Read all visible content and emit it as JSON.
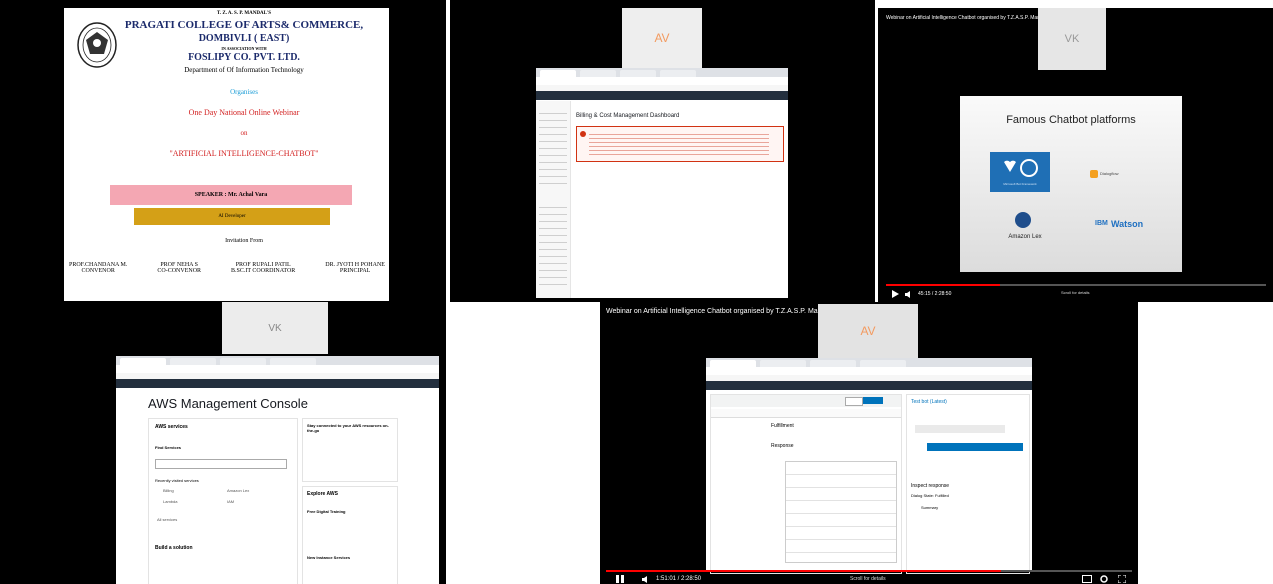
{
  "tile1": {
    "org_line1": "T. Z. A. S. P. MANDAL'S",
    "college": "PRAGATI COLLEGE OF ARTS& COMMERCE,",
    "city": "DOMBIVLI ( EAST)",
    "assoc": "IN ASSOCIATION WITH",
    "company": "FOSLIPY CO. PVT. LTD.",
    "dept": "Department of Of Information Technology",
    "organise": "Organises",
    "event": "One Day National Online Webinar",
    "on": "on",
    "topic": "\"ARTIFICIAL INTELLIGENCE-CHATBOT\"",
    "speaker": "SPEAKER : Mr. Achal Vara",
    "role": "AI Developer",
    "invitation": "Invitation From",
    "people": [
      {
        "name": "PROF.CHANDANA M.",
        "title": "CONVENOR"
      },
      {
        "name": "PROF NEHA S",
        "title": "CO-CONVENOR"
      },
      {
        "name": "PROF RUPALI PATIL",
        "title": "B.SC.IT COORDINATOR"
      },
      {
        "name": "DR. JYOTI H POHANE",
        "title": "PRINCIPAL"
      }
    ]
  },
  "tile2": {
    "avatar": "AV",
    "dashboard_title": "Billing & Cost Management Dashboard"
  },
  "tile3": {
    "title": "Webinar on Artificial Intelligence Chatbot organised by T.Z.A.S.P. Mandal's & FOSLIPY C S PVT LT",
    "avatar": "VK",
    "slide_title": "Famous Chatbot platforms",
    "platforms": [
      "Microsoft Bot Framework",
      "Dialogflow",
      "Amazon Lex",
      "IBM Watson"
    ],
    "platform_short": {
      "ibm": "IBM",
      "watson": "Watson"
    },
    "time": "45:15 / 2:28:50",
    "scroll": "Scroll for details"
  },
  "tile4": {
    "avatar": "VK",
    "console_title": "AWS Management Console",
    "aws_services": "AWS services",
    "find_services": "Find Services",
    "recently": "Recently visited services",
    "services": [
      "Billing",
      "Amazon Lex",
      "Lambda",
      "IAM"
    ],
    "all_services": "All services",
    "build": "Build a solution",
    "stay_connected": "Stay connected to your AWS resources on-the-go",
    "explore": "Explore AWS",
    "free_training": "Free Digital Training",
    "new_services": "New Instance Services"
  },
  "tile5": {
    "title": "Webinar on Artificial Intelligence Chatbot organised by T.Z.A.S.P. Mandal's & FOSLIPY C S PVT LT",
    "avatar": "AV",
    "test_bot": "Test bot (Latest)",
    "fulfillment": "Fulfillment",
    "response": "Response",
    "inspect": "Inspect response",
    "dialog_state": "Dialog State: Fulfilled",
    "summary": "Summary",
    "time": "1:51:01 / 2:28:50",
    "scroll": "Scroll for details"
  },
  "colors": {
    "speaker_bg": "#f4a7b3",
    "role_bg": "#d4a017",
    "organise": "#1a9cd6",
    "event_red": "#d21f1f",
    "avatar_text": "#f39a5f",
    "yt_red": "#ff0000",
    "aws_nav": "#232f3e"
  },
  "icons": [
    "college-emblem-icon",
    "play-icon",
    "pause-icon",
    "volume-icon",
    "settings-icon",
    "fullscreen-icon",
    "captions-icon"
  ]
}
